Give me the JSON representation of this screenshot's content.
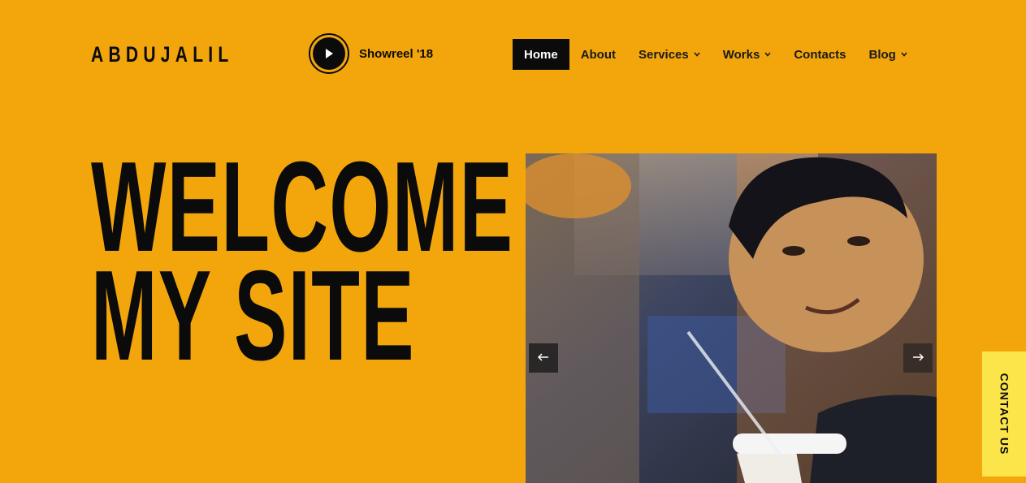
{
  "brand": {
    "logo_text": "ABDUJALIL"
  },
  "showreel": {
    "label": "Showreel '18",
    "icon": "play-icon"
  },
  "nav": {
    "items": [
      {
        "label": "Home",
        "active": true,
        "dropdown": false
      },
      {
        "label": "About",
        "active": false,
        "dropdown": false
      },
      {
        "label": "Services",
        "active": false,
        "dropdown": true
      },
      {
        "label": "Works",
        "active": false,
        "dropdown": true
      },
      {
        "label": "Contacts",
        "active": false,
        "dropdown": false
      },
      {
        "label": "Blog",
        "active": false,
        "dropdown": true
      }
    ]
  },
  "hero": {
    "line1": "WELCOME",
    "line2": "MY SITE"
  },
  "slider": {
    "prev_icon": "arrow-left-icon",
    "next_icon": "arrow-right-icon"
  },
  "contact_tab": {
    "label": "CONTACT US"
  },
  "colors": {
    "background": "#f2a60c",
    "text": "#0b0b0b",
    "active_nav_bg": "#0b0b0b",
    "contact_tab_bg": "#fce54a"
  }
}
